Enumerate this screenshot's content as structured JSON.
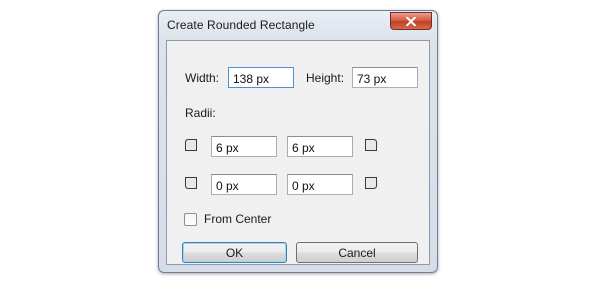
{
  "dialog": {
    "title": "Create Rounded Rectangle",
    "close_icon": "close-icon",
    "close_color": "#c9452b"
  },
  "size": {
    "width_label": "Width:",
    "width_value": "138 px",
    "height_label": "Height:",
    "height_value": "73 px"
  },
  "radii": {
    "label": "Radii:",
    "top_left": "6 px",
    "top_right": "6 px",
    "bottom_left": "0 px",
    "bottom_right": "0 px",
    "icons": [
      "corner-top-left-icon",
      "corner-top-right-icon",
      "corner-bottom-left-icon",
      "corner-bottom-right-icon"
    ]
  },
  "options": {
    "from_center_label": "From Center",
    "from_center_checked": false
  },
  "buttons": {
    "ok_label": "OK",
    "cancel_label": "Cancel"
  }
}
